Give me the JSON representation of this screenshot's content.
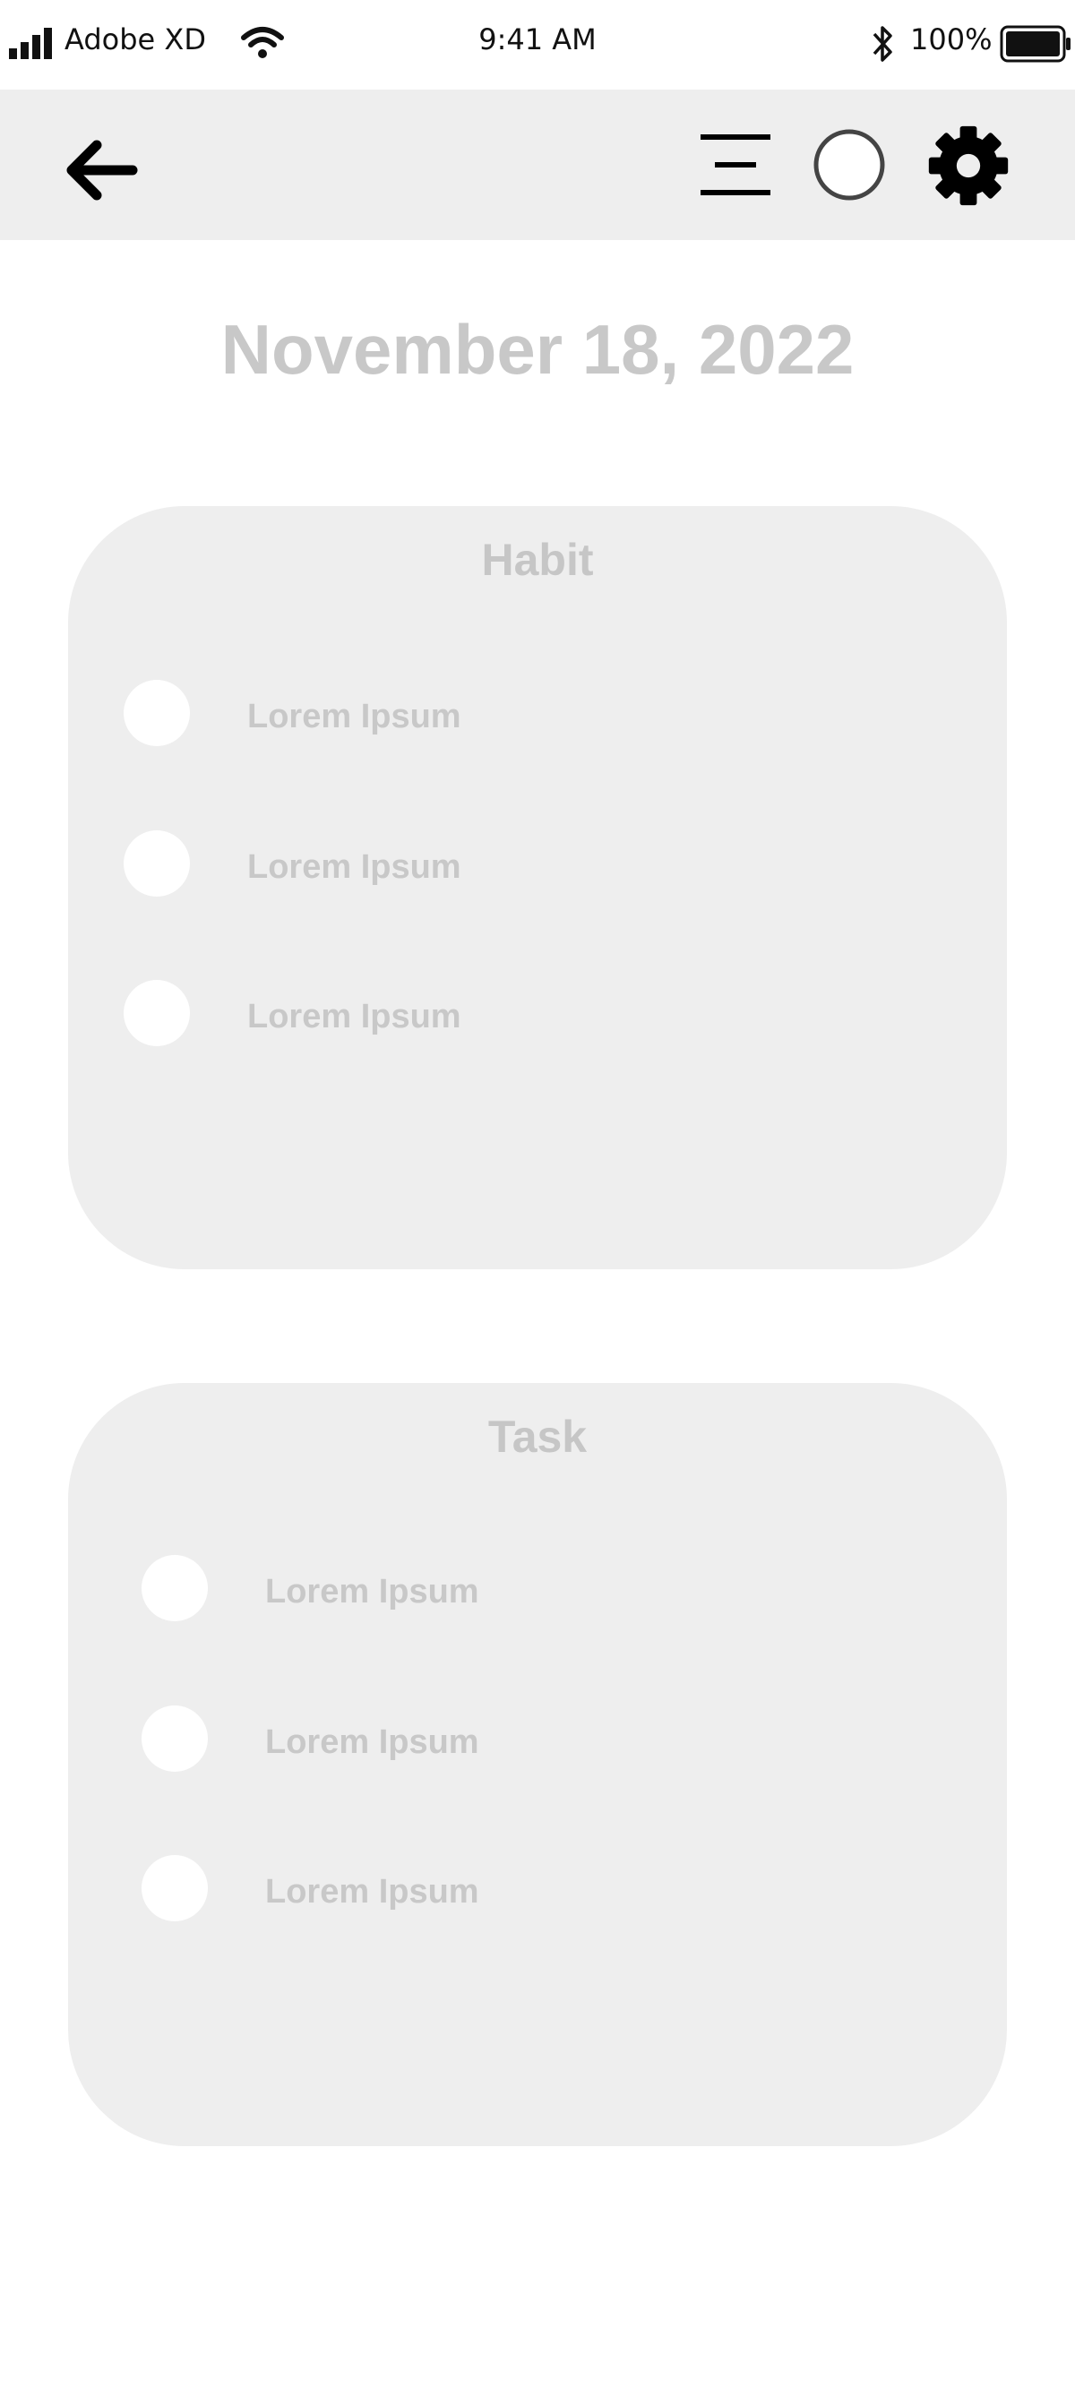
{
  "status_bar": {
    "carrier": "Adobe XD",
    "time": "9:41 AM",
    "battery_percent": "100%",
    "icons": [
      "signal-icon",
      "wifi-icon",
      "bluetooth-icon",
      "battery-icon"
    ]
  },
  "toolbar": {
    "icons": [
      "back-arrow-icon",
      "menu-icon",
      "circle-icon",
      "gear-icon"
    ]
  },
  "date": "November 18, 2022",
  "habit": {
    "title": "Habit",
    "items": [
      {
        "label": "Lorem Ipsum"
      },
      {
        "label": "Lorem Ipsum"
      },
      {
        "label": "Lorem Ipsum"
      }
    ]
  },
  "task": {
    "title": "Task",
    "items": [
      {
        "label": "Lorem Ipsum"
      },
      {
        "label": "Lorem Ipsum"
      },
      {
        "label": "Lorem Ipsum"
      }
    ]
  },
  "colors": {
    "surface": "#eeeeee",
    "muted_text": "#c8c8c8",
    "icon": "#000000"
  }
}
